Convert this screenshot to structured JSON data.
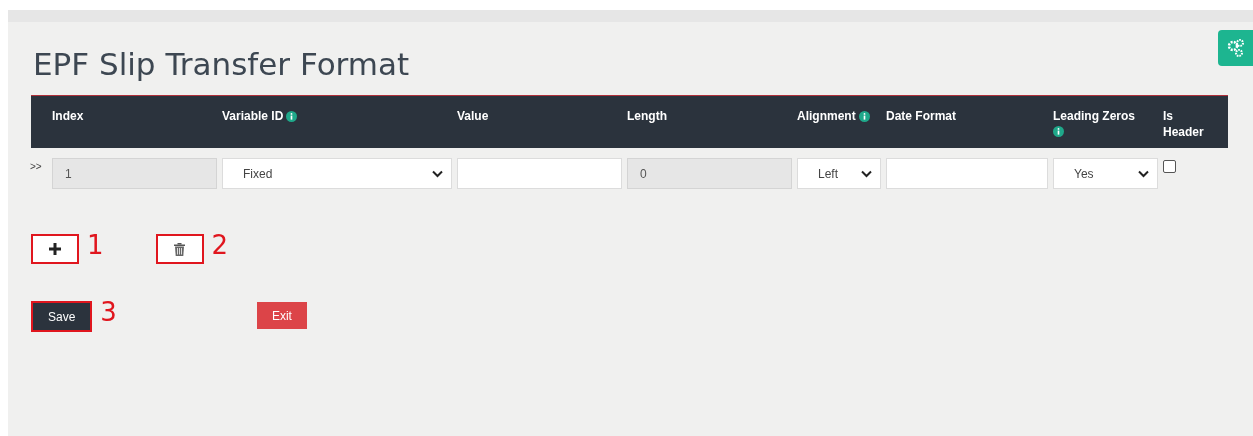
{
  "title": "EPF Slip Transfer Format",
  "columns": [
    {
      "label": "Index",
      "info": false
    },
    {
      "label": "Variable ID",
      "info": true
    },
    {
      "label": "Value",
      "info": false
    },
    {
      "label": "Length",
      "info": false
    },
    {
      "label": "Alignment",
      "info": true
    },
    {
      "label": "Date Format",
      "info": false
    },
    {
      "label": "Leading Zeros",
      "info": true
    },
    {
      "label": "Is Header",
      "info": false
    }
  ],
  "rows": [
    {
      "marker": ">>",
      "cells": [
        {
          "kind": "input",
          "value": "1",
          "disabled": true
        },
        {
          "kind": "select",
          "value": "Fixed"
        },
        {
          "kind": "input",
          "disabled": false
        },
        {
          "kind": "input",
          "value": "0",
          "disabled": true
        },
        {
          "kind": "select",
          "value": "Left"
        },
        {
          "kind": "input",
          "disabled": false
        },
        {
          "kind": "select",
          "value": "Yes"
        },
        {
          "kind": "checkbox",
          "checked": false
        }
      ]
    }
  ],
  "row_tools": [
    {
      "kind": "add",
      "annotation": "1"
    },
    {
      "kind": "delete",
      "annotation": "2"
    }
  ],
  "buttons": [
    {
      "label": "Save",
      "kind": "primary",
      "annotation": "3"
    },
    {
      "label": "Exit",
      "kind": "danger"
    }
  ]
}
